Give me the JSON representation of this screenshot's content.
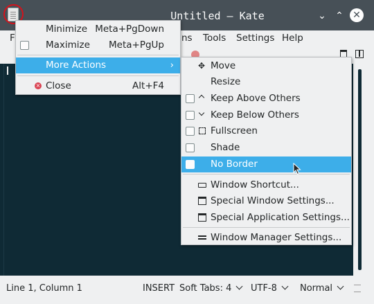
{
  "window": {
    "title": "Untitled — Kate",
    "minimize_glyph": "⌄",
    "maximize_glyph": "⌃",
    "close_glyph": "✕"
  },
  "menubar": {
    "partial_first": "F",
    "partial_view": "ns",
    "tools": "Tools",
    "settings": "Settings",
    "help": "Help"
  },
  "window_menu": {
    "items": [
      {
        "label": "Minimize",
        "shortcut": "Meta+PgDown"
      },
      {
        "label": "Maximize",
        "shortcut": "Meta+PgUp"
      },
      {
        "label": "More Actions",
        "shortcut": "›"
      },
      {
        "label": "Close",
        "shortcut": "Alt+F4"
      }
    ]
  },
  "more_actions": {
    "items": [
      {
        "label": "Move",
        "icon": "move-icon"
      },
      {
        "label": "Resize",
        "icon": ""
      },
      {
        "label": "Keep Above Others",
        "icon": "chevron-up-icon"
      },
      {
        "label": "Keep Below Others",
        "icon": "chevron-down-icon"
      },
      {
        "label": "Fullscreen",
        "icon": "fullscreen-icon"
      },
      {
        "label": "Shade",
        "icon": ""
      },
      {
        "label": "No Border",
        "icon": ""
      },
      {
        "label": "Window Shortcut...",
        "icon": "keyboard-icon"
      },
      {
        "label": "Special Window Settings...",
        "icon": "window-settings-icon"
      },
      {
        "label": "Special Application Settings...",
        "icon": "app-settings-icon"
      },
      {
        "label": "Window Manager Settings...",
        "icon": "sliders-icon"
      }
    ]
  },
  "status": {
    "position": "Line 1, Column 1",
    "mode": "INSERT",
    "tabs": "Soft Tabs: 4",
    "encoding": "UTF-8",
    "mode_select": "Normal"
  },
  "colors": {
    "titlebar": "#475057",
    "highlight": "#3daee9",
    "editor_bg": "#0f2a35",
    "annotation_circle": "#d4131c"
  }
}
